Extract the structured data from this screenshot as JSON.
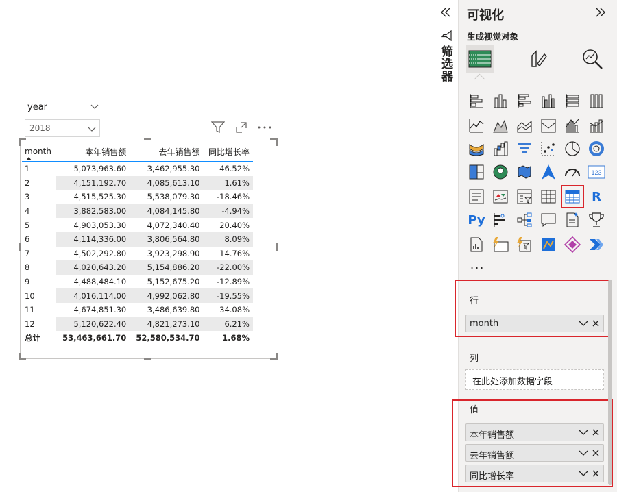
{
  "slicer": {
    "title": "year",
    "value": "2018"
  },
  "matrix": {
    "headers": [
      "month",
      "本年销售额",
      "去年销售额",
      "同比增长率"
    ],
    "rows": [
      [
        "1",
        "5,073,963.60",
        "3,462,955.30",
        "46.52%"
      ],
      [
        "2",
        "4,151,192.70",
        "4,085,613.10",
        "1.61%"
      ],
      [
        "3",
        "4,515,525.30",
        "5,538,079.30",
        "-18.46%"
      ],
      [
        "4",
        "3,882,583.00",
        "4,084,145.80",
        "-4.94%"
      ],
      [
        "5",
        "4,903,053.30",
        "4,072,340.40",
        "20.40%"
      ],
      [
        "6",
        "4,114,336.00",
        "3,806,564.80",
        "8.09%"
      ],
      [
        "7",
        "4,502,292.80",
        "3,923,298.90",
        "14.76%"
      ],
      [
        "8",
        "4,020,643.20",
        "5,154,886.20",
        "-22.00%"
      ],
      [
        "9",
        "4,488,484.10",
        "5,152,675.20",
        "-12.89%"
      ],
      [
        "10",
        "4,016,114.00",
        "4,992,062.80",
        "-19.55%"
      ],
      [
        "11",
        "4,674,851.30",
        "3,486,639.80",
        "34.08%"
      ],
      [
        "12",
        "5,120,622.40",
        "4,821,273.10",
        "6.21%"
      ]
    ],
    "total": [
      "总计",
      "53,463,661.70",
      "52,580,534.70",
      "1.68%"
    ]
  },
  "filter_pane": {
    "label": "筛选器"
  },
  "viz_pane": {
    "title": "可视化",
    "build_label": "生成视觉对象",
    "more": "...",
    "r_label": "R",
    "py_label": "Py",
    "card_label": "123"
  },
  "wells": {
    "rows": {
      "title": "行",
      "fields": [
        "month"
      ]
    },
    "columns": {
      "title": "列",
      "placeholder": "在此处添加数据字段"
    },
    "values": {
      "title": "值",
      "fields": [
        "本年销售额",
        "去年销售额",
        "同比增长率"
      ]
    }
  },
  "colors": {
    "accent": "#118dff",
    "highlight": "#d9262c",
    "pane_bg": "#f3f2f1"
  }
}
